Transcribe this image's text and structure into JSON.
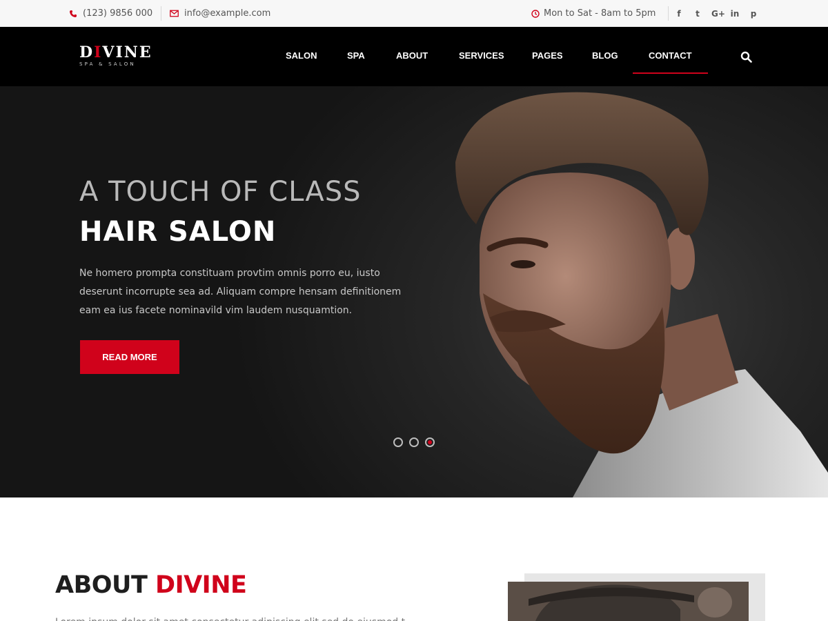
{
  "topbar": {
    "phone": "(123) 9856 000",
    "email": "info@example.com",
    "hours": "Mon to Sat - 8am to 5pm",
    "social": [
      {
        "glyph": "f",
        "icon": "facebook-icon"
      },
      {
        "glyph": "t",
        "icon": "twitter-icon"
      },
      {
        "glyph": "G+",
        "icon": "google-plus-icon"
      },
      {
        "glyph": "in",
        "icon": "linkedin-icon"
      },
      {
        "glyph": "p",
        "icon": "pinterest-icon"
      }
    ]
  },
  "header": {
    "logo_pre": "D",
    "logo_mid": "I",
    "logo_post": "VINE",
    "logo_sub": "SPA & SALON",
    "nav": [
      "SALON",
      "SPA",
      "ABOUT",
      "SERVICES",
      "PAGES",
      "BLOG",
      "CONTACT"
    ],
    "active": "CONTACT"
  },
  "hero": {
    "title_line1": "A TOUCH OF CLASS",
    "title_line2": "HAIR SALON",
    "text": "Ne homero prompta constituam provtim omnis porro eu, iusto deserunt incorrupte sea ad. Aliquam compre hensam definitionem eam ea ius facete nominavild vim laudem nusquamtion.",
    "button": "READ MORE",
    "slides": 3,
    "active_slide": 3
  },
  "about": {
    "title_dark": "ABOUT",
    "title_red": "DIVINE",
    "intro": "Lorem ipsum dolor sit amet consectetur adipiscing elit sed do eiusmod t"
  },
  "colors": {
    "accent": "#d0021b",
    "header_bg": "#000000",
    "topbar_bg": "#f7f7f7"
  }
}
